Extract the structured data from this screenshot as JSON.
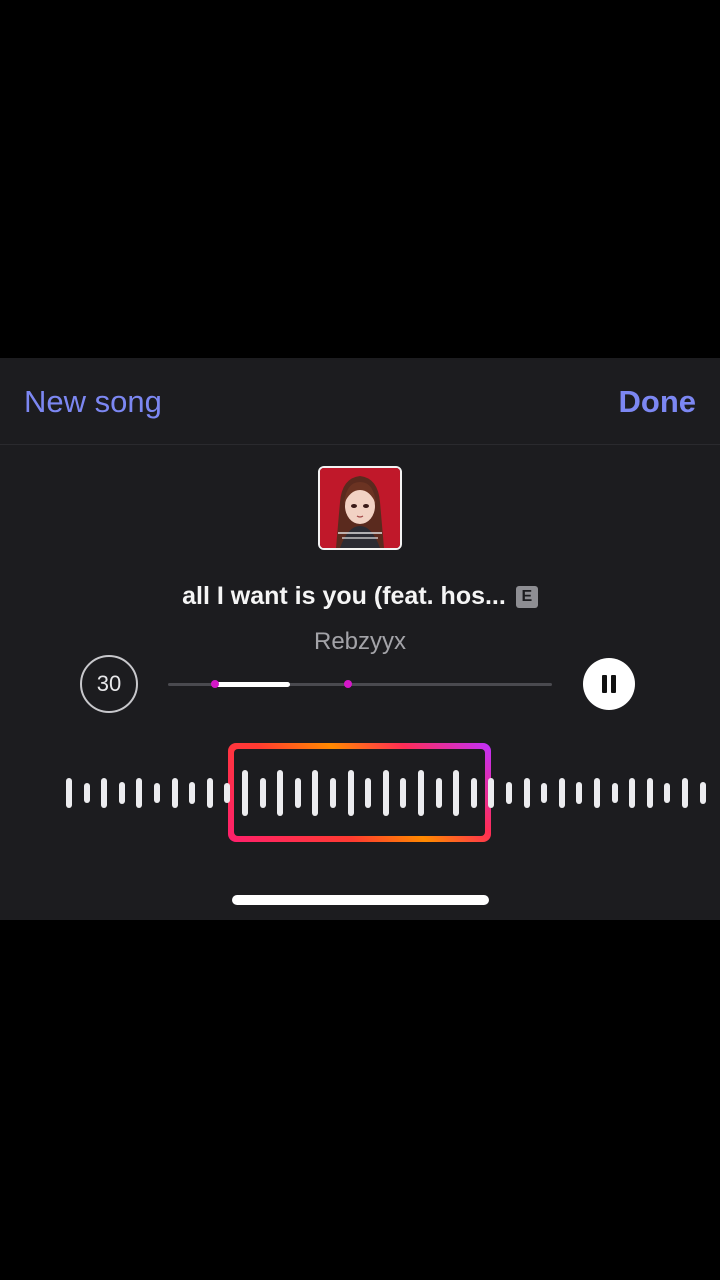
{
  "header": {
    "left_label": "New song",
    "right_label": "Done"
  },
  "track": {
    "title": "all I want is you (feat. hos...",
    "explicit_badge": "E",
    "artist": "Rebzyyx"
  },
  "controls": {
    "duration_label": "30",
    "progress_fraction": 0.2,
    "playing": true
  },
  "colors": {
    "accent": "#7c87f2",
    "sheet_bg": "#1c1c1f",
    "marker": "#d417c8"
  },
  "icons": {
    "play_state": "pause-icon"
  }
}
